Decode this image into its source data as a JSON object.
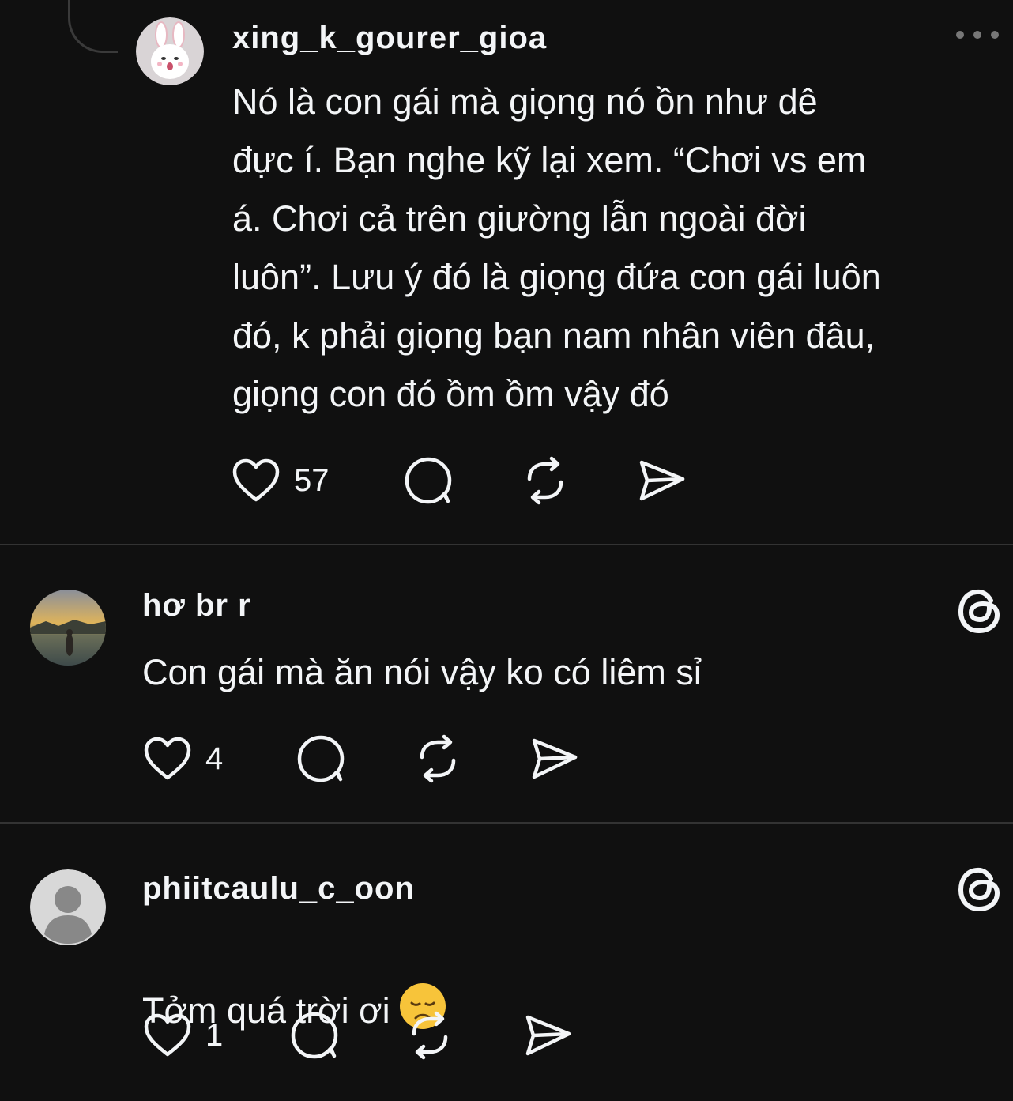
{
  "comments": [
    {
      "username": "xing_k_gourer_gioa",
      "text": "Nó là con gái mà giọng nó ồn như dê\nđực í. Bạn nghe kỹ lại xem. “Chơi vs em\ná. Chơi cả trên giường lẫn ngoài đời\nluôn”. Lưu ý đó là giọng đứa con gái luôn\nđó, k phải giọng bạn nam nhân viên đâu,\ngiọng con đó ồm ồm vậy đó",
      "like_count": "57",
      "avatar_icon": "bunny-avatar-icon",
      "menu_icon": "more-options-icon"
    },
    {
      "username": "hơ   br        r",
      "text": "Con gái mà ăn nói vậy ko có liêm sỉ",
      "like_count": "4",
      "avatar_icon": "sunset-photo-avatar",
      "badge_icon": "threads-logo-icon"
    },
    {
      "username": "phiitcaulu_c_oon",
      "text": "Tởm quá trời ơi",
      "emoji": "disappointed-face-emoji",
      "like_count": "1",
      "avatar_icon": "default-user-avatar-icon",
      "badge_icon": "threads-logo-icon"
    }
  ],
  "colors": {
    "background": "#101010",
    "text": "#f3f5f7",
    "divider": "#333333",
    "muted": "#777777"
  }
}
